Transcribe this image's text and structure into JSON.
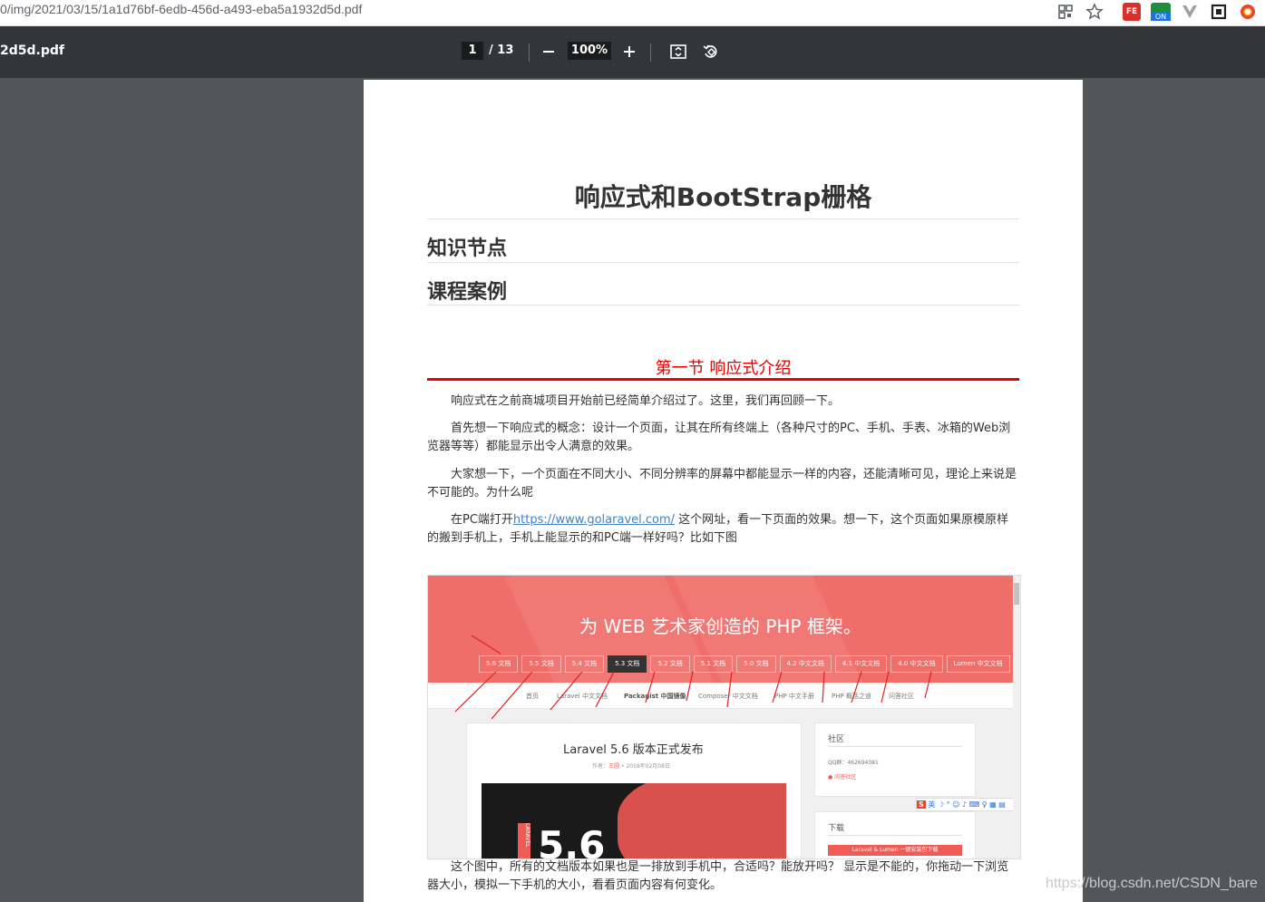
{
  "browser": {
    "url": "0/img/2021/03/15/1a1d76bf-6edb-456d-a493-eba5a1932d5d.pdf",
    "ext_on_label": "ON",
    "ext_fe_label": "FE"
  },
  "pdf_toolbar": {
    "file_name": "2d5d.pdf",
    "page_current": "1",
    "page_total": "/ 13",
    "zoom": "100%",
    "zoom_out_icon": "minus-icon",
    "zoom_in_icon": "plus-icon",
    "fit_icon": "fit-page-icon",
    "rotate_icon": "rotate-icon"
  },
  "document": {
    "title": "响应式和BootStrap栅格",
    "heading_1": "知识节点",
    "heading_2": "课程案例",
    "section_title": "第一节 响应式介绍",
    "paragraphs": {
      "p1": "响应式在之前商城项目开始前已经简单介绍过了。这里，我们再回顾一下。",
      "p2": "首先想一下响应式的概念：设计一个页面，让其在所有终端上（各种尺寸的PC、手机、手表、冰箱的Web浏览器等等）都能显示出令人满意的效果。",
      "p3": "大家想一下，一个页面在不同大小、不同分辨率的屏幕中都能显示一样的内容，还能清晰可见，理论上来说是不可能的。为什么呢",
      "p4_pre": "在PC端打开",
      "p4_link": "https://www.golaravel.com/",
      "p4_post": " 这个网址，看一下页面的效果。想一下，这个页面如果原模原样的搬到手机上，手机上能显示的和PC端一样好吗？比如下图",
      "p5": "这个图中，所有的文档版本如果也是一排放到手机中，合适吗？能放开吗？ 显示是不能的，你拖动一下浏览器大小，模拟一下手机的大小，看看页面内容有何变化。"
    }
  },
  "screenshot": {
    "hero_title": "为 WEB 艺术家创造的 PHP 框架。",
    "version_tabs": [
      "5.6 文档",
      "5.5 文档",
      "5.4 文档",
      "5.3 文档",
      "5.2 文档",
      "5.1 文档",
      "5.0 文档",
      "4.2 中文文档",
      "4.1 中文文档",
      "4.0 中文文档",
      "Lumen 中文文档"
    ],
    "subnav": [
      "首页",
      "Laravel 中文文档",
      "Packagist 中国镜像",
      "Composer 中文文档",
      "PHP 中文手册",
      "PHP 概括之道",
      "问答社区"
    ],
    "article_title": "Laravel 5.6 版本正式发布",
    "article_meta_prefix": "作者：",
    "article_author": "王圆",
    "article_date": "• 2018年02月08日",
    "cover_text": "5.6",
    "cover_side": "LARAVEL",
    "community_title": "社区",
    "qq_group": "QQ群：462694081",
    "forum_link": "问答社区",
    "download_title": "下载",
    "download_button": "Laravel & Lumen 一键安装包下载",
    "ime_logo": "S",
    "ime_text": "英 ☽ ° ☺ ♪ ⌨ ♀ ▦ ▤"
  },
  "watermark": "https://blog.csdn.net/CSDN_bare",
  "colors": {
    "toolbar_bg": "#323639",
    "viewer_bg": "#525659",
    "section_red": "#e60000",
    "hero_red": "#ef6e6a",
    "link_blue": "#4183c4"
  }
}
